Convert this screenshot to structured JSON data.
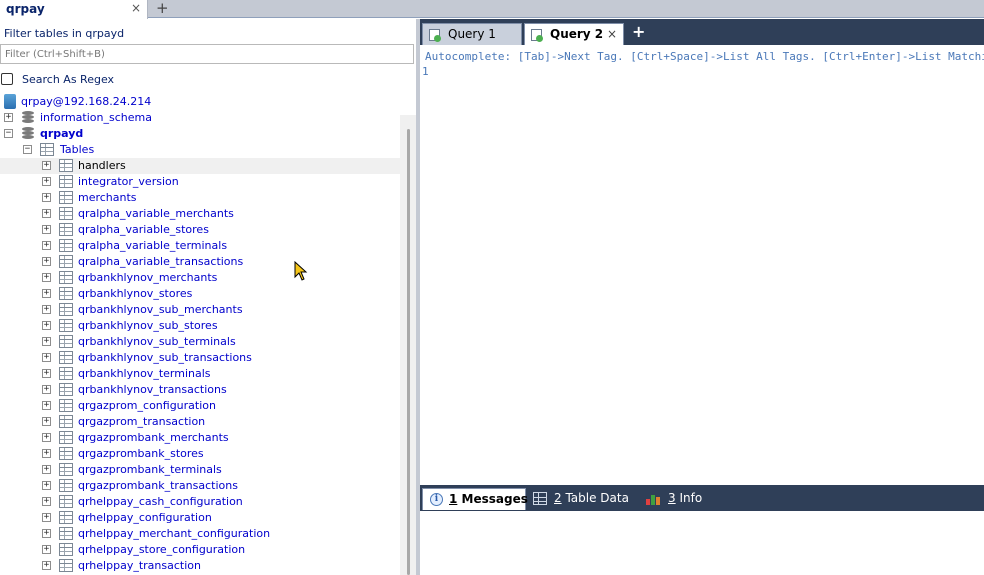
{
  "connection_tab": {
    "label": "qrpay",
    "close": "×",
    "add": "+"
  },
  "filter": {
    "label": "Filter tables in qrpayd",
    "placeholder": "Filter (Ctrl+Shift+B)",
    "regex_label": "Search As Regex"
  },
  "tree": {
    "server": "qrpay@192.168.24.214",
    "databases": [
      {
        "name": "information_schema",
        "expanded": false
      },
      {
        "name": "qrpayd",
        "expanded": true
      }
    ],
    "tables_folder": "Tables",
    "selected_table": "handlers",
    "tables": [
      "handlers",
      "integrator_version",
      "merchants",
      "qralpha_variable_merchants",
      "qralpha_variable_stores",
      "qralpha_variable_terminals",
      "qralpha_variable_transactions",
      "qrbankhlynov_merchants",
      "qrbankhlynov_stores",
      "qrbankhlynov_sub_merchants",
      "qrbankhlynov_sub_stores",
      "qrbankhlynov_sub_terminals",
      "qrbankhlynov_sub_transactions",
      "qrbankhlynov_terminals",
      "qrbankhlynov_transactions",
      "qrgazprom_configuration",
      "qrgazprom_transaction",
      "qrgazprombank_merchants",
      "qrgazprombank_stores",
      "qrgazprombank_terminals",
      "qrgazprombank_transactions",
      "qrhelppay_cash_configuration",
      "qrhelppay_configuration",
      "qrhelppay_merchant_configuration",
      "qrhelppay_store_configuration",
      "qrhelppay_transaction"
    ]
  },
  "query_tabs": [
    {
      "label": "Query 1",
      "active": false
    },
    {
      "label": "Query 2",
      "active": true,
      "close": "×"
    }
  ],
  "query_add": "+",
  "editor": {
    "hint": "Autocomplete: [Tab]->Next Tag. [Ctrl+Space]->List All Tags. [Ctrl+Enter]->List Matching Tags. [Ctrl+Shift+Space]->List Functions",
    "line_number": "1"
  },
  "result_tabs": [
    {
      "num": "1",
      "label": " Messages",
      "active": true,
      "icon": "info-icon"
    },
    {
      "num": "2",
      "label": " Table Data",
      "active": false,
      "icon": "grid-icon"
    },
    {
      "num": "3",
      "label": " Info",
      "active": false,
      "icon": "chart-icon"
    }
  ],
  "colors": {
    "link_blue": "#0000cc",
    "tab_strip": "#2f3f58",
    "hint_blue": "#4a78b8"
  }
}
